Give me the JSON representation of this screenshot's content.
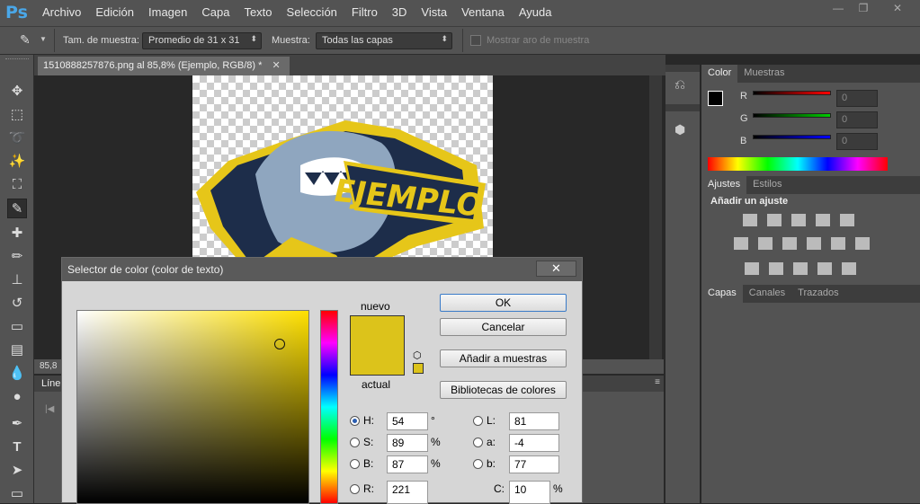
{
  "app": {
    "logo": "Ps"
  },
  "menu": [
    "Archivo",
    "Edición",
    "Imagen",
    "Capa",
    "Texto",
    "Selección",
    "Filtro",
    "3D",
    "Vista",
    "Ventana",
    "Ayuda"
  ],
  "window_controls": {
    "minimize": "—",
    "restore": "❐",
    "close": "✕"
  },
  "options": {
    "sample_size_label": "Tam. de muestra:",
    "sample_size_value": "Promedio de 31 x 31",
    "sample_label": "Muestra:",
    "sample_value": "Todas las capas",
    "show_ring_label": "Mostrar aro de muestra"
  },
  "document": {
    "tab_title": "1510888257876.png al 85,8% (Ejemplo, RGB/8) *",
    "zoom": "85,8",
    "logo_text": "EJEMPLO"
  },
  "timeline": {
    "label": "Líne"
  },
  "color_panel": {
    "tabs": [
      "Color",
      "Muestras"
    ],
    "channels": [
      {
        "name": "R",
        "value": "0"
      },
      {
        "name": "G",
        "value": "0"
      },
      {
        "name": "B",
        "value": "0"
      }
    ]
  },
  "adjustments_panel": {
    "tabs": [
      "Ajustes",
      "Estilos"
    ],
    "heading": "Añadir un ajuste"
  },
  "layers_panel": {
    "tabs": [
      "Capas",
      "Canales",
      "Trazados"
    ]
  },
  "color_picker": {
    "title": "Selector de color (color de texto)",
    "close": "✕",
    "new_label": "nuevo",
    "current_label": "actual",
    "new_color": "#dcc31b",
    "current_color": "#dcc31b",
    "buttons": {
      "ok": "OK",
      "cancel": "Cancelar",
      "add_swatch": "Añadir a muestras",
      "libraries": "Bibliotecas de colores"
    },
    "hsb": [
      {
        "name": "H:",
        "value": "54",
        "unit": "°",
        "selected": true
      },
      {
        "name": "S:",
        "value": "89",
        "unit": "%",
        "selected": false
      },
      {
        "name": "B:",
        "value": "87",
        "unit": "%",
        "selected": false
      }
    ],
    "lab": [
      {
        "name": "L:",
        "value": "81"
      },
      {
        "name": "a:",
        "value": "-4"
      },
      {
        "name": "b:",
        "value": "77"
      }
    ],
    "rgb": [
      {
        "name": "R:",
        "value": "221"
      }
    ],
    "cmyk": [
      {
        "name": "C:",
        "value": "10",
        "unit": "%"
      }
    ]
  },
  "colors": {
    "accent": "#4aa7e8",
    "panel_bg": "#535353",
    "dark_bg": "#282828"
  }
}
